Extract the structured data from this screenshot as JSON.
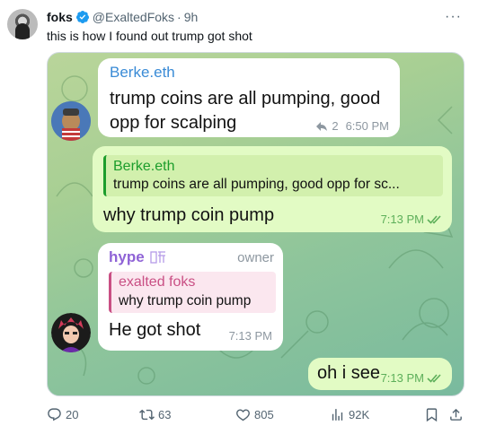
{
  "tweet": {
    "author_name": "foks",
    "handle": "@ExaltedFoks",
    "separator": "·",
    "time": "9h",
    "more": "···",
    "text": "this is how I found out trump got shot"
  },
  "chat": {
    "msg1": {
      "sender": "Berke.eth",
      "line1": "trump coins are all pumping, good",
      "line2": "opp for scalping",
      "replies": "2",
      "time": "6:50 PM"
    },
    "msg2": {
      "reply_sender": "Berke.eth",
      "reply_text": "trump coins are all pumping, good opp for sc...",
      "text": "why trump coin pump",
      "time": "7:13 PM"
    },
    "msg3": {
      "sender": "hype",
      "role": "owner",
      "reply_sender": "exalted foks",
      "reply_text": "why trump coin pump",
      "text": "He got shot",
      "time": "7:13 PM"
    },
    "msg4": {
      "text": "oh i see",
      "time": "7:13 PM"
    }
  },
  "actions": {
    "replies": "20",
    "reposts": "63",
    "likes": "805",
    "views": "92K"
  },
  "colors": {
    "sender_blue": "#3a8bd6",
    "reply_green": "#1c9d2c",
    "owner_purple": "#8f63d6",
    "reply_pink": "#c94f84",
    "outgoing_bubble": "#e2fbc4",
    "check_green": "#5daf5a"
  }
}
